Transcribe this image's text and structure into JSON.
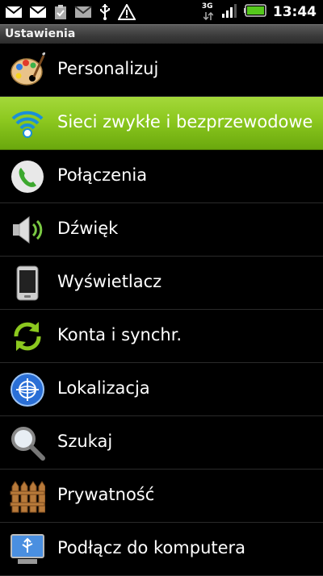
{
  "status": {
    "time": "13:44",
    "network": "3G",
    "icons": [
      "mail-icon",
      "mail-icon",
      "task-check-icon",
      "mail-icon",
      "usb-icon",
      "warning-icon"
    ]
  },
  "title": "Ustawienia",
  "items": [
    {
      "label": "Personalizuj",
      "icon": "palette-icon"
    },
    {
      "label": "Sieci zwykłe i bezprzewodowe",
      "icon": "wifi-icon",
      "selected": true
    },
    {
      "label": "Połączenia",
      "icon": "phone-icon"
    },
    {
      "label": "Dźwięk",
      "icon": "speaker-icon"
    },
    {
      "label": "Wyświetlacz",
      "icon": "display-phone-icon"
    },
    {
      "label": "Konta i synchr.",
      "icon": "sync-icon"
    },
    {
      "label": "Lokalizacja",
      "icon": "location-icon"
    },
    {
      "label": "Szukaj",
      "icon": "search-icon"
    },
    {
      "label": "Prywatność",
      "icon": "fence-icon"
    },
    {
      "label": "Podłącz do komputera",
      "icon": "usb-connect-icon"
    }
  ],
  "colors": {
    "selected": "#8cc81f",
    "background": "#000000"
  }
}
